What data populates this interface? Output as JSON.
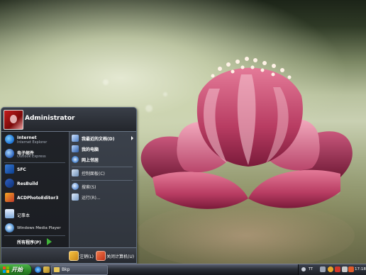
{
  "start_menu": {
    "username": "Administrator",
    "pinned": [
      {
        "title": "Internet",
        "subtitle": "Internet Explorer",
        "icon": "internet-explorer-icon"
      },
      {
        "title": "电子邮件",
        "subtitle": "Outlook Express",
        "icon": "outlook-express-icon"
      }
    ],
    "recent": [
      {
        "label": "SFC",
        "icon": "sfc-icon"
      },
      {
        "label": "ResBuild",
        "icon": "resbuild-icon"
      },
      {
        "label": "ACDPhotoEditor3",
        "icon": "acdphotoeditor-icon"
      },
      {
        "label": "记事本",
        "icon": "notepad-icon"
      },
      {
        "label": "Windows Media Player",
        "icon": "media-player-icon"
      }
    ],
    "all_programs": "所有程序(P)",
    "places": [
      {
        "label": "我最近的文档(D)",
        "icon": "recent-documents-icon"
      },
      {
        "label": "我的电脑",
        "icon": "my-computer-icon"
      },
      {
        "label": "网上邻居",
        "icon": "network-places-icon"
      },
      {
        "label": "控制面板(C)",
        "icon": "control-panel-icon"
      },
      {
        "label": "搜索(S)",
        "icon": "search-icon"
      },
      {
        "label": "运行(R)...",
        "icon": "run-icon"
      }
    ],
    "logoff": "注销(L)",
    "shutdown": "关闭计算机(U)"
  },
  "taskbar": {
    "start_label": "开始",
    "task_label": "Bkp",
    "language": "TT",
    "clock": "17:18"
  },
  "colors": {
    "start_green": "#2e8a2a",
    "menu_dark": "#202328",
    "menu_right": "#3b414b"
  }
}
